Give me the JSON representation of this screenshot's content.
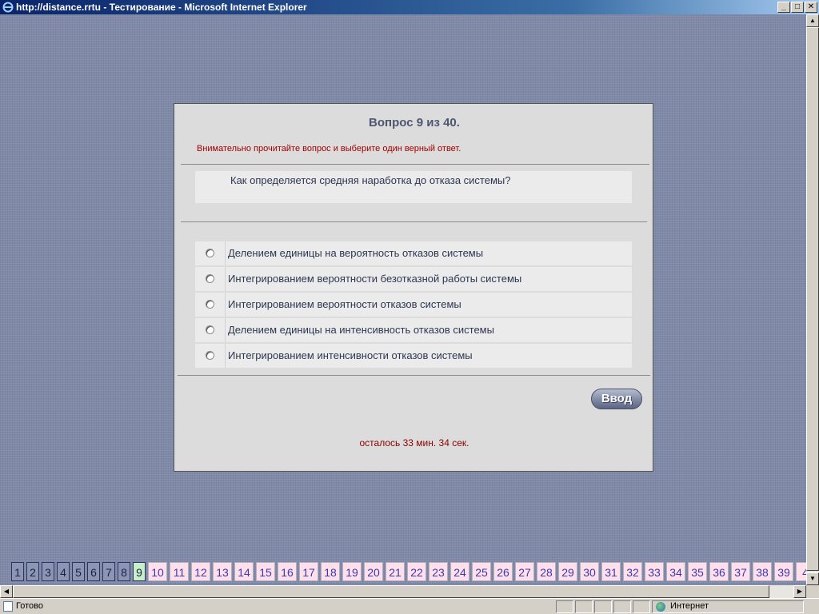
{
  "window": {
    "title": "http://distance.rrtu - Тестирование - Microsoft Internet Explorer",
    "minimize_label": "_",
    "maximize_label": "□",
    "close_label": "✕"
  },
  "test": {
    "question_header": "Вопрос 9 из 40.",
    "instruction": "Внимательно прочитайте вопрос и выберите один верный ответ.",
    "question": "Как определяется средняя наработка до отказа системы?",
    "answers": [
      {
        "label": "Делением единицы на вероятность отказов системы",
        "selected": false
      },
      {
        "label": "Интегрированием вероятности безотказной работы системы",
        "selected": false
      },
      {
        "label": "Интегрированием вероятности отказов системы",
        "selected": false
      },
      {
        "label": "Делением единицы на интенсивность отказов системы",
        "selected": false
      },
      {
        "label": "Интегрированием интенсивности отказов системы",
        "selected": false
      }
    ],
    "submit_label": "Ввод",
    "timer": "осталось 33 мин. 34 сек."
  },
  "nav": {
    "current": 9,
    "answered_through": 8,
    "numbers": [
      "1",
      "2",
      "3",
      "4",
      "5",
      "6",
      "7",
      "8",
      "9",
      "10",
      "11",
      "12",
      "13",
      "14",
      "15",
      "16",
      "17",
      "18",
      "19",
      "20",
      "21",
      "22",
      "23",
      "24",
      "25",
      "26",
      "27",
      "28",
      "29",
      "30",
      "31",
      "32",
      "33",
      "34",
      "35",
      "36",
      "37",
      "38",
      "39",
      "4"
    ]
  },
  "statusbar": {
    "status": "Готово",
    "zone": "Интернет"
  },
  "colors": {
    "answered": "#8b95b4",
    "current": "#c8f0c8",
    "unanswered": "#ffe0ea",
    "instruction": "#a00000"
  }
}
